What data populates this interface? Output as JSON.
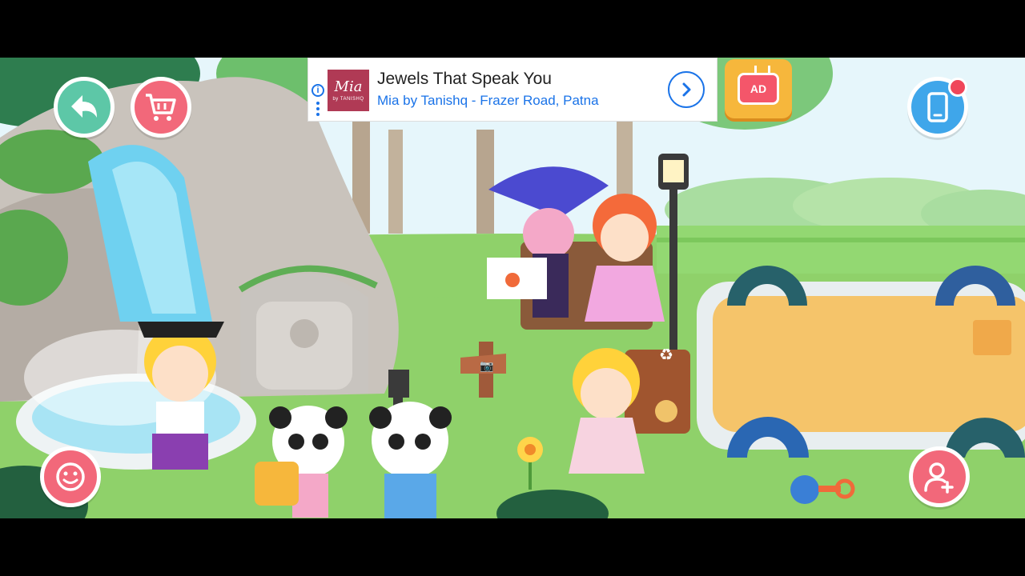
{
  "ad": {
    "title": "Jewels That Speak You",
    "subtitle": "Mia by Tanishq - Frazer Road, Patna",
    "logo_main": "Mia",
    "logo_sub": "by TANISHQ",
    "info_glyph": "i"
  },
  "ad_tv": {
    "label": "AD"
  },
  "buttons": {
    "back_icon": "back-arrow-icon",
    "cart_icon": "shopping-cart-icon",
    "phone_icon": "phone-icon",
    "emoji_icon": "smile-face-icon",
    "add_user_icon": "add-user-icon"
  },
  "scene_items": {
    "sign_symbol": "📷",
    "recycle_symbol": "♻"
  },
  "colors": {
    "accent_green": "#5dc7a7",
    "accent_pink": "#f2687a",
    "accent_blue": "#3fa6ea",
    "ad_link_blue": "#1a73e8",
    "sand": "#f5c46a",
    "grass": "#8fd16a"
  }
}
